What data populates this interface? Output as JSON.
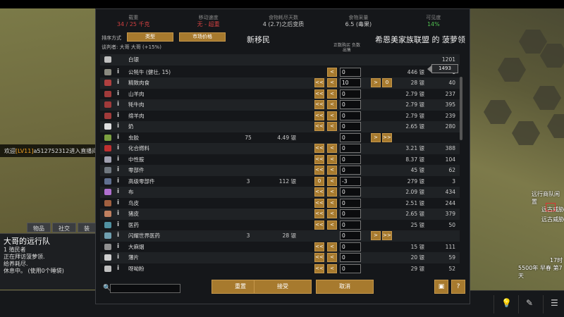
{
  "stats": [
    {
      "label": "载重",
      "value": "34 / 25 千克",
      "status": "red"
    },
    {
      "label": "移动速度",
      "value": "无 - 超重",
      "status": "red"
    },
    {
      "label": "食物耗尽天数",
      "value": "4 (2.7)之后变质",
      "status": "normal"
    },
    {
      "label": "食物采量",
      "value": "6.5 (毒果)",
      "status": "normal"
    },
    {
      "label": "可见度",
      "value": "14%",
      "status": "green"
    }
  ],
  "sort": {
    "label": "排序方式",
    "by_type": "类型",
    "by_market": "市场价格"
  },
  "negotiator": "谈判者: 大哥 大哥 (+15%)",
  "colony_name": "新移民",
  "trader_name": "希恩美家族联盟 的 菠萝领",
  "column_header": "正数购买 负数出售",
  "silver_row": {
    "name": "白银",
    "transfer": "1493",
    "trader_count": "1201"
  },
  "items": [
    {
      "name": "公牦牛 (健壮, 15)",
      "colony_count": "",
      "colony_price": "",
      "btns": [
        "<"
      ],
      "qty": "0",
      "right_btns": [],
      "trader_price": "446 银",
      "trader_count": "1",
      "icon": "#8a8a80"
    },
    {
      "name": "精致肉食",
      "colony_count": "",
      "colony_price": "",
      "btns": [
        "<<",
        "<"
      ],
      "qty": "10",
      "right_btns": [
        ">",
        "0"
      ],
      "trader_price": "28 银",
      "trader_count": "40",
      "icon": "#b04040"
    },
    {
      "name": "山羊肉",
      "colony_count": "",
      "colony_price": "",
      "btns": [
        "<<",
        "<"
      ],
      "qty": "0",
      "right_btns": [],
      "trader_price": "2.79 银",
      "trader_count": "237",
      "icon": "#a03a3a"
    },
    {
      "name": "牦牛肉",
      "colony_count": "",
      "colony_price": "",
      "btns": [
        "<<",
        "<"
      ],
      "qty": "0",
      "right_btns": [],
      "trader_price": "2.79 银",
      "trader_count": "395",
      "icon": "#a03a3a"
    },
    {
      "name": "绵羊肉",
      "colony_count": "",
      "colony_price": "",
      "btns": [
        "<<",
        "<"
      ],
      "qty": "0",
      "right_btns": [],
      "trader_price": "2.79 银",
      "trader_count": "239",
      "icon": "#a03a3a"
    },
    {
      "name": "奶",
      "colony_count": "",
      "colony_price": "",
      "btns": [
        "<<",
        "<"
      ],
      "qty": "0",
      "right_btns": [],
      "trader_price": "2.65 银",
      "trader_count": "280",
      "icon": "#e0e0e0"
    },
    {
      "name": "虫胶",
      "colony_count": "75",
      "colony_price": "4.49 银",
      "btns": [],
      "qty": "0",
      "right_btns": [
        ">",
        ">>"
      ],
      "trader_price": "",
      "trader_count": "",
      "icon": "#7ca040"
    },
    {
      "name": "化合燃料",
      "colony_count": "",
      "colony_price": "",
      "btns": [
        "<<",
        "<"
      ],
      "qty": "0",
      "right_btns": [],
      "trader_price": "3.21 银",
      "trader_count": "388",
      "icon": "#c03030"
    },
    {
      "name": "中性胺",
      "colony_count": "",
      "colony_price": "",
      "btns": [
        "<<",
        "<"
      ],
      "qty": "0",
      "right_btns": [],
      "trader_price": "8.37 银",
      "trader_count": "104",
      "icon": "#a0a0b0"
    },
    {
      "name": "零部件",
      "colony_count": "",
      "colony_price": "",
      "btns": [
        "<<",
        "<"
      ],
      "qty": "0",
      "right_btns": [],
      "trader_price": "45 银",
      "trader_count": "62",
      "icon": "#707880"
    },
    {
      "name": "高级零部件",
      "colony_count": "3",
      "colony_price": "112 银",
      "btns": [
        "0",
        "<"
      ],
      "qty": "-3",
      "right_btns": [],
      "trader_price": "279 银",
      "trader_count": "3",
      "icon": "#607090"
    },
    {
      "name": "布",
      "colony_count": "",
      "colony_price": "",
      "btns": [
        "<<",
        "<"
      ],
      "qty": "0",
      "right_btns": [],
      "trader_price": "2.09 银",
      "trader_count": "434",
      "icon": "#b070d0"
    },
    {
      "name": "鸟皮",
      "colony_count": "",
      "colony_price": "",
      "btns": [
        "<<",
        "<"
      ],
      "qty": "0",
      "right_btns": [],
      "trader_price": "2.51 银",
      "trader_count": "244",
      "icon": "#a06040"
    },
    {
      "name": "猪皮",
      "colony_count": "",
      "colony_price": "",
      "btns": [
        "<<",
        "<"
      ],
      "qty": "0",
      "right_btns": [],
      "trader_price": "2.65 银",
      "trader_count": "379",
      "icon": "#c08060"
    },
    {
      "name": "医药",
      "colony_count": "",
      "colony_price": "",
      "btns": [
        "<<",
        "<"
      ],
      "qty": "0",
      "right_btns": [],
      "trader_price": "25 银",
      "trader_count": "50",
      "icon": "#5090a0"
    },
    {
      "name": "闪耀世界医药",
      "colony_count": "3",
      "colony_price": "28 银",
      "btns": [],
      "qty": "0",
      "right_btns": [
        ">",
        ">>"
      ],
      "trader_price": "",
      "trader_count": "",
      "icon": "#70a0b0"
    },
    {
      "name": "大麻烟",
      "colony_count": "",
      "colony_price": "",
      "btns": [
        "<<",
        "<"
      ],
      "qty": "0",
      "right_btns": [],
      "trader_price": "15 银",
      "trader_count": "111",
      "icon": "#909090"
    },
    {
      "name": "薄片",
      "colony_count": "",
      "colony_price": "",
      "btns": [
        "<<",
        "<"
      ],
      "qty": "0",
      "right_btns": [],
      "trader_price": "20 银",
      "trader_count": "59",
      "icon": "#d0d0d0"
    },
    {
      "name": "呀呦粉",
      "colony_count": "",
      "colony_price": "",
      "btns": [
        "<<",
        "<"
      ],
      "qty": "0",
      "right_btns": [],
      "trader_price": "29 银",
      "trader_count": "52",
      "icon": "#c0c0c0"
    }
  ],
  "buttons": {
    "reset": "重置",
    "accept": "接受",
    "cancel": "取消",
    "info": "?"
  },
  "left": {
    "welcome_prefix": "欢迎",
    "welcome_level": "[LV11]",
    "welcome_rest": "a512752312进入直播间",
    "tabs": [
      "物品",
      "社交",
      "装"
    ],
    "caravan_title": "大哥的远行队",
    "caravan_lines": [
      "1 殖民者",
      "正在拜访菠萝领.",
      "给养耗尽.",
      "休息中。 (使用0个睡袋)"
    ]
  },
  "right": {
    "label_caravan": "远行商队闲置",
    "label_dock": "远古威胁",
    "label_dock2": "远古威胁",
    "time": "17时",
    "date": "5500年 早春 第7天"
  }
}
